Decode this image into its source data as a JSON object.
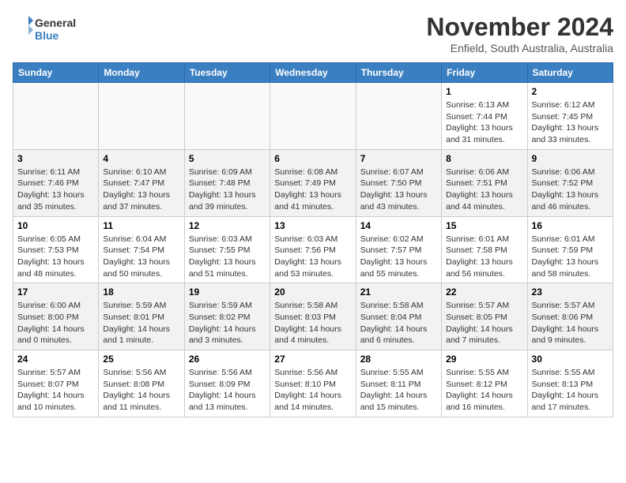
{
  "header": {
    "logo_general": "General",
    "logo_blue": "Blue",
    "month": "November 2024",
    "location": "Enfield, South Australia, Australia"
  },
  "days_of_week": [
    "Sunday",
    "Monday",
    "Tuesday",
    "Wednesday",
    "Thursday",
    "Friday",
    "Saturday"
  ],
  "weeks": [
    [
      {
        "day": "",
        "info": ""
      },
      {
        "day": "",
        "info": ""
      },
      {
        "day": "",
        "info": ""
      },
      {
        "day": "",
        "info": ""
      },
      {
        "day": "",
        "info": ""
      },
      {
        "day": "1",
        "info": "Sunrise: 6:13 AM\nSunset: 7:44 PM\nDaylight: 13 hours and 31 minutes."
      },
      {
        "day": "2",
        "info": "Sunrise: 6:12 AM\nSunset: 7:45 PM\nDaylight: 13 hours and 33 minutes."
      }
    ],
    [
      {
        "day": "3",
        "info": "Sunrise: 6:11 AM\nSunset: 7:46 PM\nDaylight: 13 hours and 35 minutes."
      },
      {
        "day": "4",
        "info": "Sunrise: 6:10 AM\nSunset: 7:47 PM\nDaylight: 13 hours and 37 minutes."
      },
      {
        "day": "5",
        "info": "Sunrise: 6:09 AM\nSunset: 7:48 PM\nDaylight: 13 hours and 39 minutes."
      },
      {
        "day": "6",
        "info": "Sunrise: 6:08 AM\nSunset: 7:49 PM\nDaylight: 13 hours and 41 minutes."
      },
      {
        "day": "7",
        "info": "Sunrise: 6:07 AM\nSunset: 7:50 PM\nDaylight: 13 hours and 43 minutes."
      },
      {
        "day": "8",
        "info": "Sunrise: 6:06 AM\nSunset: 7:51 PM\nDaylight: 13 hours and 44 minutes."
      },
      {
        "day": "9",
        "info": "Sunrise: 6:06 AM\nSunset: 7:52 PM\nDaylight: 13 hours and 46 minutes."
      }
    ],
    [
      {
        "day": "10",
        "info": "Sunrise: 6:05 AM\nSunset: 7:53 PM\nDaylight: 13 hours and 48 minutes."
      },
      {
        "day": "11",
        "info": "Sunrise: 6:04 AM\nSunset: 7:54 PM\nDaylight: 13 hours and 50 minutes."
      },
      {
        "day": "12",
        "info": "Sunrise: 6:03 AM\nSunset: 7:55 PM\nDaylight: 13 hours and 51 minutes."
      },
      {
        "day": "13",
        "info": "Sunrise: 6:03 AM\nSunset: 7:56 PM\nDaylight: 13 hours and 53 minutes."
      },
      {
        "day": "14",
        "info": "Sunrise: 6:02 AM\nSunset: 7:57 PM\nDaylight: 13 hours and 55 minutes."
      },
      {
        "day": "15",
        "info": "Sunrise: 6:01 AM\nSunset: 7:58 PM\nDaylight: 13 hours and 56 minutes."
      },
      {
        "day": "16",
        "info": "Sunrise: 6:01 AM\nSunset: 7:59 PM\nDaylight: 13 hours and 58 minutes."
      }
    ],
    [
      {
        "day": "17",
        "info": "Sunrise: 6:00 AM\nSunset: 8:00 PM\nDaylight: 14 hours and 0 minutes."
      },
      {
        "day": "18",
        "info": "Sunrise: 5:59 AM\nSunset: 8:01 PM\nDaylight: 14 hours and 1 minute."
      },
      {
        "day": "19",
        "info": "Sunrise: 5:59 AM\nSunset: 8:02 PM\nDaylight: 14 hours and 3 minutes."
      },
      {
        "day": "20",
        "info": "Sunrise: 5:58 AM\nSunset: 8:03 PM\nDaylight: 14 hours and 4 minutes."
      },
      {
        "day": "21",
        "info": "Sunrise: 5:58 AM\nSunset: 8:04 PM\nDaylight: 14 hours and 6 minutes."
      },
      {
        "day": "22",
        "info": "Sunrise: 5:57 AM\nSunset: 8:05 PM\nDaylight: 14 hours and 7 minutes."
      },
      {
        "day": "23",
        "info": "Sunrise: 5:57 AM\nSunset: 8:06 PM\nDaylight: 14 hours and 9 minutes."
      }
    ],
    [
      {
        "day": "24",
        "info": "Sunrise: 5:57 AM\nSunset: 8:07 PM\nDaylight: 14 hours and 10 minutes."
      },
      {
        "day": "25",
        "info": "Sunrise: 5:56 AM\nSunset: 8:08 PM\nDaylight: 14 hours and 11 minutes."
      },
      {
        "day": "26",
        "info": "Sunrise: 5:56 AM\nSunset: 8:09 PM\nDaylight: 14 hours and 13 minutes."
      },
      {
        "day": "27",
        "info": "Sunrise: 5:56 AM\nSunset: 8:10 PM\nDaylight: 14 hours and 14 minutes."
      },
      {
        "day": "28",
        "info": "Sunrise: 5:55 AM\nSunset: 8:11 PM\nDaylight: 14 hours and 15 minutes."
      },
      {
        "day": "29",
        "info": "Sunrise: 5:55 AM\nSunset: 8:12 PM\nDaylight: 14 hours and 16 minutes."
      },
      {
        "day": "30",
        "info": "Sunrise: 5:55 AM\nSunset: 8:13 PM\nDaylight: 14 hours and 17 minutes."
      }
    ]
  ]
}
